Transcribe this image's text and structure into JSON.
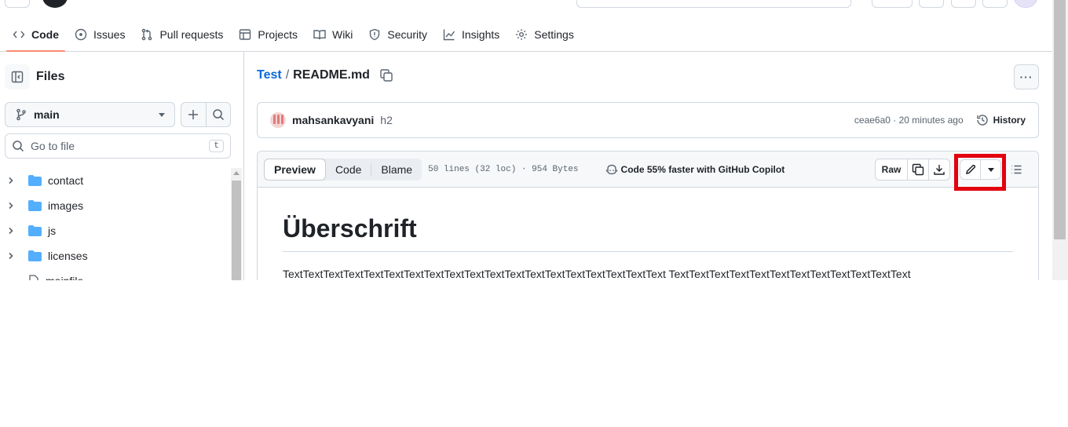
{
  "repo_nav": {
    "tabs": [
      {
        "label": "Code",
        "icon": "code-icon",
        "active": true
      },
      {
        "label": "Issues",
        "icon": "issue-icon"
      },
      {
        "label": "Pull requests",
        "icon": "pull-request-icon"
      },
      {
        "label": "Projects",
        "icon": "table-icon"
      },
      {
        "label": "Wiki",
        "icon": "book-icon"
      },
      {
        "label": "Security",
        "icon": "shield-icon"
      },
      {
        "label": "Insights",
        "icon": "graph-icon"
      },
      {
        "label": "Settings",
        "icon": "gear-icon"
      }
    ]
  },
  "sidebar": {
    "title": "Files",
    "branch": "main",
    "goto_placeholder": "Go to file",
    "goto_shortcut": "t",
    "tree": [
      {
        "name": "contact",
        "type": "folder"
      },
      {
        "name": "images",
        "type": "folder"
      },
      {
        "name": "js",
        "type": "folder"
      },
      {
        "name": "licenses",
        "type": "folder"
      },
      {
        "name": "mainfile",
        "type": "file"
      }
    ]
  },
  "breadcrumb": {
    "repo": "Test",
    "separator": "/",
    "file": "README.md"
  },
  "commit": {
    "author": "mahsankavyani",
    "message": "h2",
    "meta": "ceae6a0 · 20 minutes ago",
    "history_label": "History"
  },
  "file_header": {
    "tabs": [
      "Preview",
      "Code",
      "Blame"
    ],
    "active_tab": "Preview",
    "info": "50 lines (32 loc) · 954 Bytes",
    "copilot": "Code 55% faster with GitHub Copilot",
    "raw_label": "Raw",
    "highlight_color": "#e3000f"
  },
  "content": {
    "heading": "Überschrift",
    "paragraph": "TextTextTextTextTextTextTextTextTextTextTextTextTextTextTextTextTextTextText TextTextTextTextTextTextTextTextTextTextTextText"
  }
}
